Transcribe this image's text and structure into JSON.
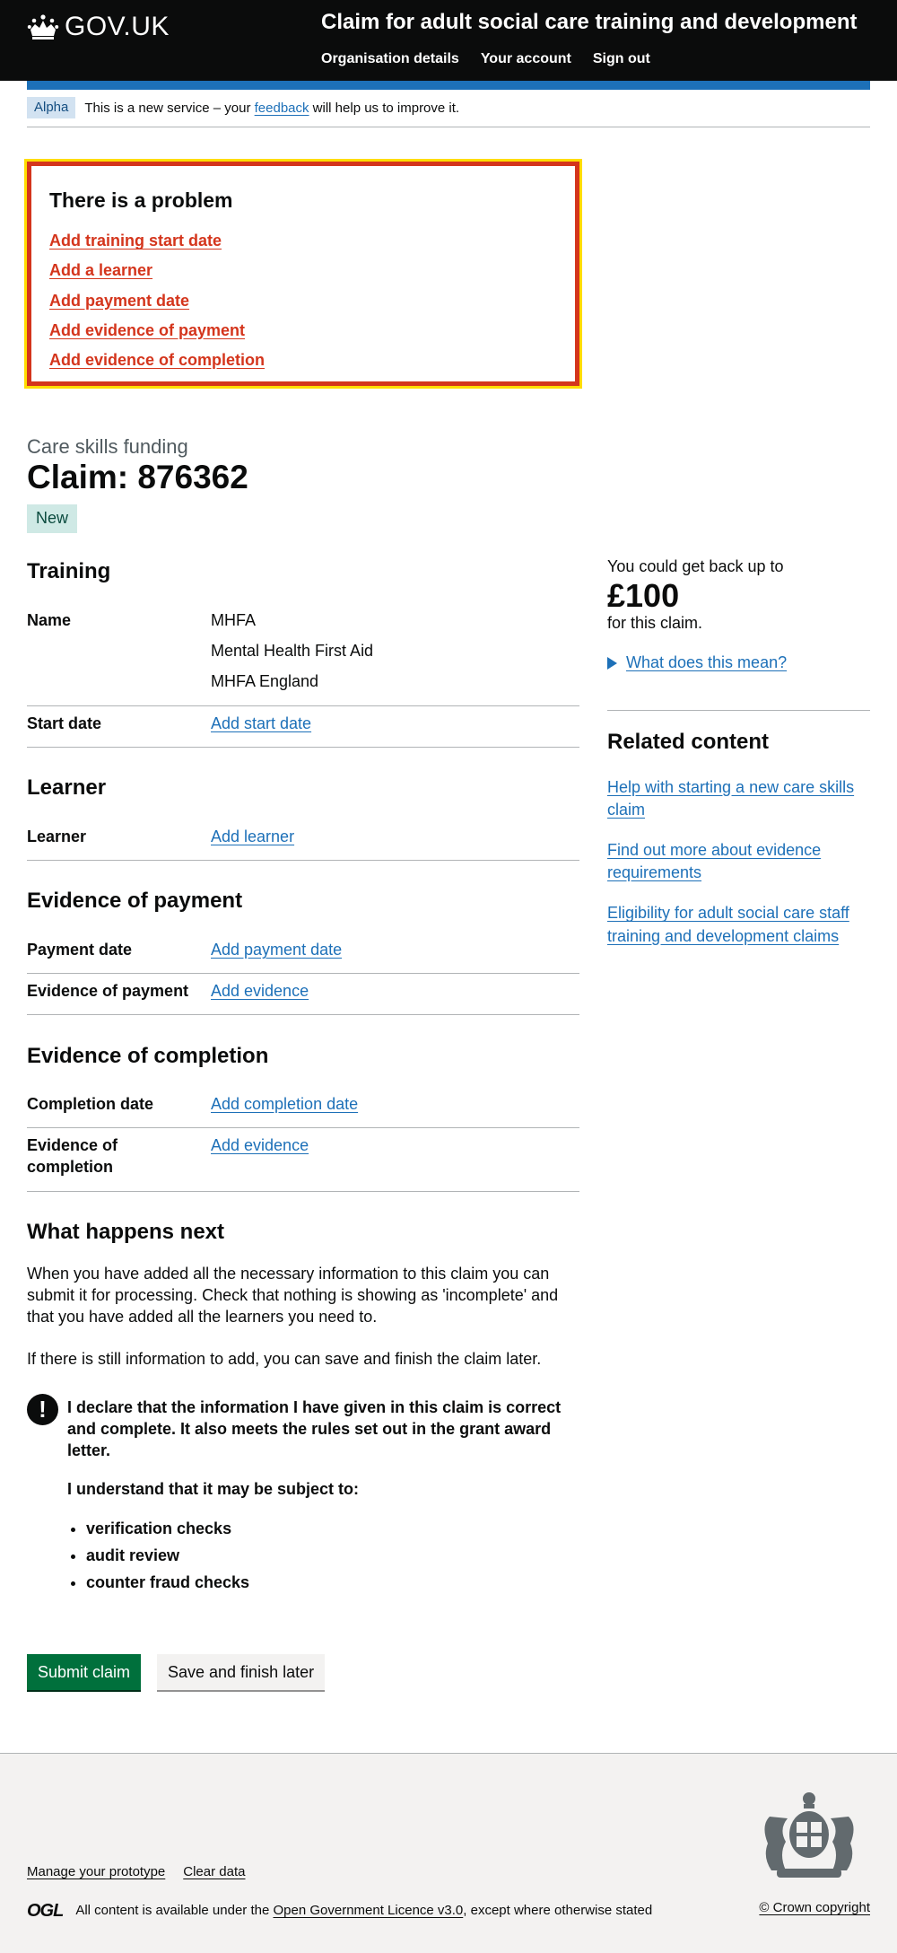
{
  "header": {
    "logo_text": "GOV.UK",
    "service_name": "Claim for adult social care training and development",
    "nav": [
      "Organisation details",
      "Your account",
      "Sign out"
    ]
  },
  "phase": {
    "tag": "Alpha",
    "text_before": "This is a new service – your ",
    "link": "feedback",
    "text_after": " will help us to improve it."
  },
  "error_summary": {
    "title": "There is a problem",
    "items": [
      "Add training start date",
      "Add a learner",
      "Add payment date",
      "Add evidence of payment",
      "Add evidence of completion"
    ]
  },
  "caption": "Care skills funding",
  "title": "Claim: 876362",
  "status_tag": "New",
  "training": {
    "heading": "Training",
    "name_key": "Name",
    "name_values": [
      "MHFA",
      "Mental Health First Aid",
      "MHFA England"
    ],
    "start_key": "Start date",
    "start_action": "Add start date"
  },
  "learner": {
    "heading": "Learner",
    "key": "Learner",
    "action": "Add learner"
  },
  "payment": {
    "heading": "Evidence of payment",
    "date_key": "Payment date",
    "date_action": "Add payment date",
    "evidence_key": "Evidence of payment",
    "evidence_action": "Add evidence"
  },
  "completion": {
    "heading": "Evidence of completion",
    "date_key": "Completion date",
    "date_action": "Add completion date",
    "evidence_key": "Evidence of completion",
    "evidence_action": "Add evidence"
  },
  "sidebar": {
    "intro": "You could get back up to",
    "amount": "£100",
    "suffix": "for this claim.",
    "details_link": "What does this mean?",
    "related_heading": "Related content",
    "related_links": [
      "Help with starting a new care skills claim",
      "Find out more about evidence requirements",
      "Eligibility for adult social care staff training and development claims"
    ]
  },
  "next": {
    "heading": "What happens next",
    "para1": "When you have added all the necessary information to this claim you can submit it for processing. Check that nothing is showing as 'incomplete' and that you have added all the learners you need to.",
    "para2": "If there is still information to add, you can save and finish the claim later.",
    "warning_icon": "!",
    "declaration": "I declare that the information I have given in this claim is correct and complete. It also meets the rules set out in the grant award letter.",
    "understand": "I understand that it may be subject to:",
    "checks": [
      "verification checks",
      "audit review",
      "counter fraud checks"
    ]
  },
  "buttons": {
    "submit": "Submit claim",
    "save": "Save and finish later"
  },
  "footer": {
    "links": [
      "Manage your prototype",
      "Clear data"
    ],
    "ogl": "OGL",
    "licence_before": "All content is available under the ",
    "licence_link": "Open Government Licence v3.0",
    "licence_after": ", except where otherwise stated",
    "copyright": "© Crown copyright"
  }
}
